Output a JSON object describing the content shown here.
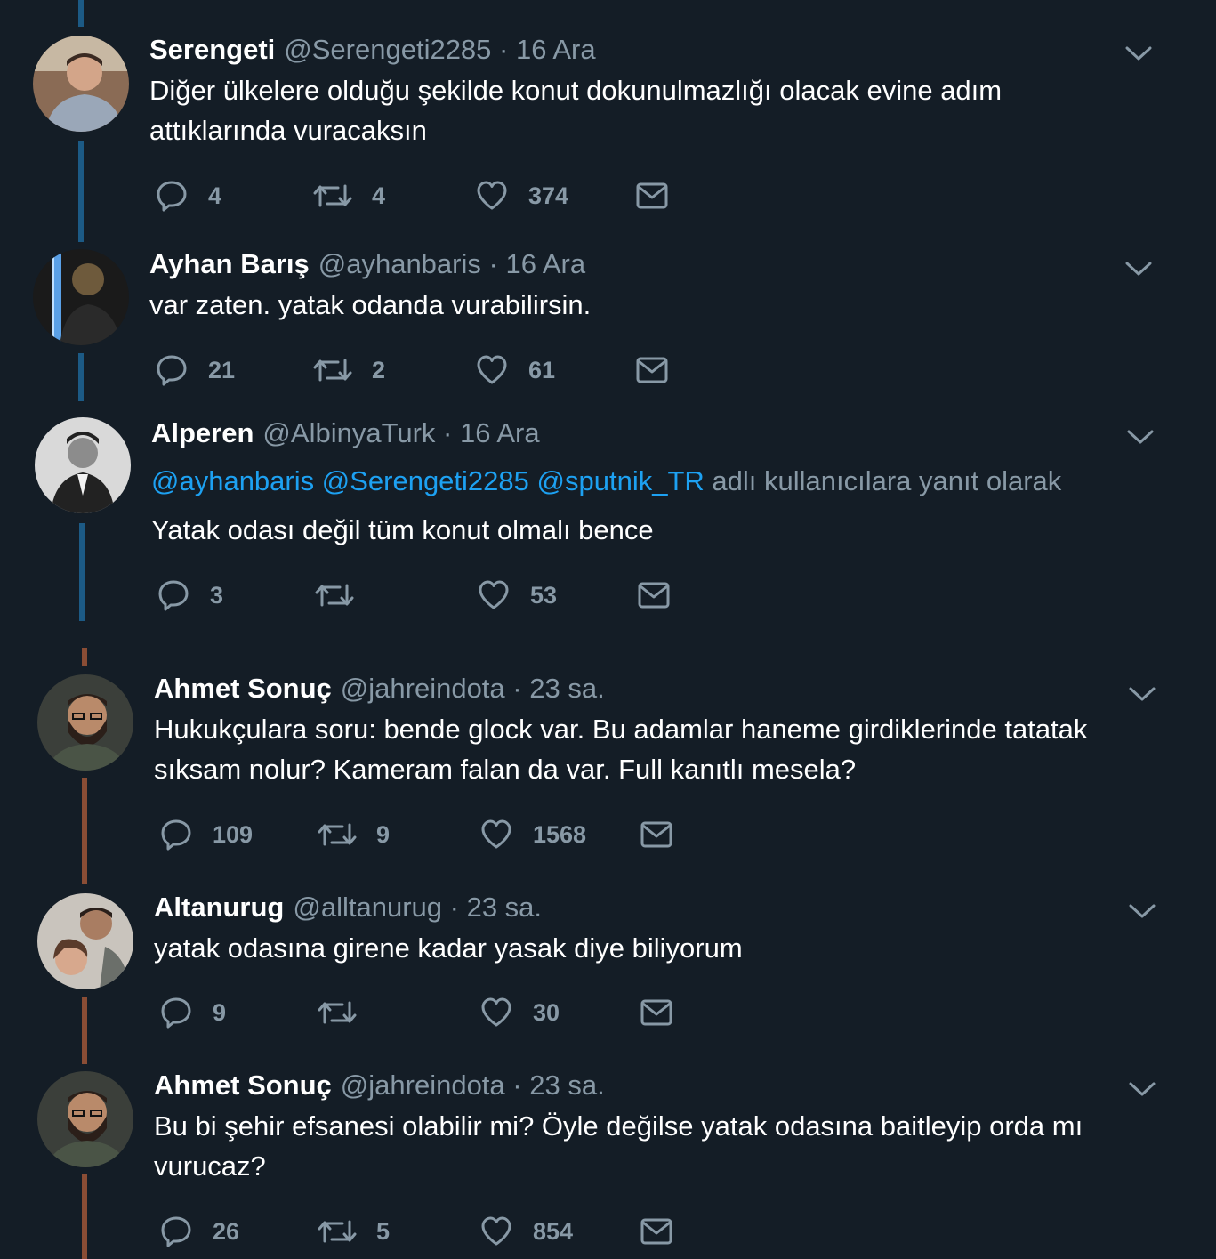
{
  "tweets": [
    {
      "name": "Serengeti",
      "handle": "@Serengeti2285",
      "sep": "·",
      "time": "16 Ara",
      "text": "Diğer ülkelere olduğu şekilde konut dokunulmazlığı olacak evine adım attıklarında vuracaksın",
      "replies": "4",
      "retweets": "4",
      "likes": "374"
    },
    {
      "name": "Ayhan Barış",
      "handle": "@ayhanbaris",
      "sep": "·",
      "time": "16 Ara",
      "text": "var zaten. yatak odanda vurabilirsin.",
      "replies": "21",
      "retweets": "2",
      "likes": "61"
    },
    {
      "name": "Alperen",
      "handle": "@AlbinyaTurk",
      "sep": "·",
      "time": "16 Ara",
      "reply_to": {
        "mention_1": "@ayhanbaris",
        "mention_2": "@Serengeti2285",
        "mention_3": "@sputnik_TR",
        "suffix": "adlı kullanıcılara yanıt olarak"
      },
      "text": "Yatak odası değil tüm konut olmalı bence",
      "replies": "3",
      "retweets": "",
      "likes": "53"
    },
    {
      "name": "Ahmet Sonuç",
      "handle": "@jahreindota",
      "sep": "·",
      "time": "23 sa.",
      "text": "Hukukçulara soru: bende glock var. Bu adamlar haneme girdiklerinde tatatak sıksam nolur? Kameram falan da var. Full kanıtlı mesela?",
      "replies": "109",
      "retweets": "9",
      "likes": "1568"
    },
    {
      "name": "Altanurug",
      "handle": "@alltanurug",
      "sep": "·",
      "time": "23 sa.",
      "text": "yatak odasına girene kadar yasak diye biliyorum",
      "replies": "9",
      "retweets": "",
      "likes": "30"
    },
    {
      "name": "Ahmet Sonuç",
      "handle": "@jahreindota",
      "sep": "·",
      "time": "23 sa.",
      "text": "Bu bi şehir efsanesi olabilir mi? Öyle değilse yatak odasına baitleyip orda mı vurucaz?",
      "replies": "26",
      "retweets": "5",
      "likes": "854"
    }
  ],
  "icons": {
    "reply": "reply-icon",
    "retweet": "retweet-icon",
    "like": "heart-icon",
    "dm": "envelope-icon",
    "menu": "chevron-down-icon"
  },
  "colors": {
    "background": "#141d26",
    "text": "#ffffff",
    "secondary": "#8899a6",
    "mention": "#1da1f2",
    "thread_line_blue": "#1c5a85",
    "thread_line_brown": "#8a4d35"
  }
}
